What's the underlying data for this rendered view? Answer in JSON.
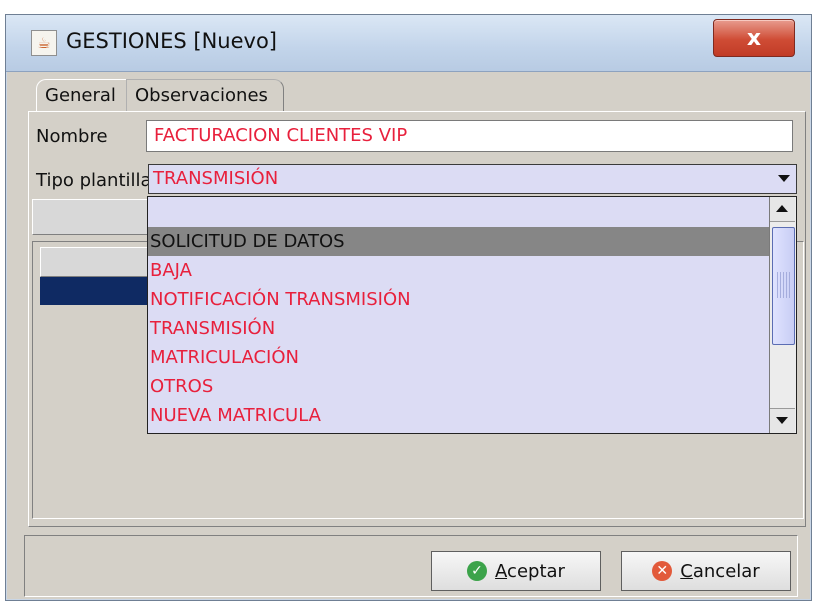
{
  "window": {
    "title": "GESTIONES [Nuevo]",
    "close_symbol": "x",
    "app_icon": "java-icon"
  },
  "tabs": [
    {
      "label": "General"
    },
    {
      "label": "Observaciones"
    }
  ],
  "form": {
    "nombre_label": "Nombre",
    "nombre_value": "FACTURACION CLIENTES VIP",
    "tipo_label": "Tipo plantilla",
    "tipo_value": "TRANSMISIÓN"
  },
  "dropdown": {
    "items": [
      "",
      "SOLICITUD DE DATOS",
      "BAJA",
      "NOTIFICACIÓN TRANSMISIÓN",
      "TRANSMISIÓN",
      "MATRICULACIÓN",
      "OTROS",
      "NUEVA MATRICULA"
    ],
    "selected_index": 1
  },
  "buttons": {
    "accept_prefix": "",
    "accept_mnemonic": "A",
    "accept_rest": "ceptar",
    "cancel_mnemonic": "C",
    "cancel_rest": "ancelar"
  },
  "colors": {
    "field_text": "#e8203c",
    "selected_row": "#868686",
    "dropdown_bg": "#dcdcf4",
    "accept_icon": "#3ca34a",
    "cancel_icon": "#e25a3b"
  }
}
